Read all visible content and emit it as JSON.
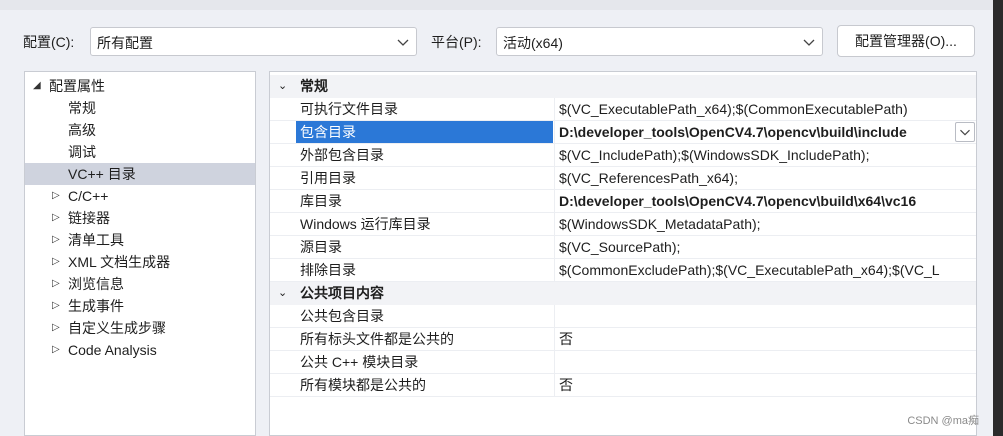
{
  "toolbar": {
    "config_label": "配置(C):",
    "config_value": "所有配置",
    "platform_label": "平台(P):",
    "platform_value": "活动(x64)",
    "manager_button": "配置管理器(O)..."
  },
  "tree": {
    "root": "配置属性",
    "items": [
      {
        "label": "常规",
        "expandable": false
      },
      {
        "label": "高级",
        "expandable": false
      },
      {
        "label": "调试",
        "expandable": false
      },
      {
        "label": "VC++ 目录",
        "expandable": false,
        "selected": true
      },
      {
        "label": "C/C++",
        "expandable": true
      },
      {
        "label": "链接器",
        "expandable": true
      },
      {
        "label": "清单工具",
        "expandable": true
      },
      {
        "label": "XML 文档生成器",
        "expandable": true
      },
      {
        "label": "浏览信息",
        "expandable": true
      },
      {
        "label": "生成事件",
        "expandable": true
      },
      {
        "label": "自定义生成步骤",
        "expandable": true
      },
      {
        "label": "Code Analysis",
        "expandable": true
      }
    ]
  },
  "grid": {
    "sections": [
      {
        "title": "常规",
        "rows": [
          {
            "key": "可执行文件目录",
            "value": "$(VC_ExecutablePath_x64);$(CommonExecutablePath)",
            "bold": false
          },
          {
            "key": "包含目录",
            "value": "D:\\developer_tools\\OpenCV4.7\\opencv\\build\\include",
            "bold": true,
            "selected": true
          },
          {
            "key": "外部包含目录",
            "value": "$(VC_IncludePath);$(WindowsSDK_IncludePath);",
            "bold": false
          },
          {
            "key": "引用目录",
            "value": "$(VC_ReferencesPath_x64);",
            "bold": false
          },
          {
            "key": "库目录",
            "value": "D:\\developer_tools\\OpenCV4.7\\opencv\\build\\x64\\vc16",
            "bold": true
          },
          {
            "key": "Windows 运行库目录",
            "value": "$(WindowsSDK_MetadataPath);",
            "bold": false
          },
          {
            "key": "源目录",
            "value": "$(VC_SourcePath);",
            "bold": false
          },
          {
            "key": "排除目录",
            "value": "$(CommonExcludePath);$(VC_ExecutablePath_x64);$(VC_L",
            "bold": false
          }
        ]
      },
      {
        "title": "公共项目内容",
        "rows": [
          {
            "key": "公共包含目录",
            "value": "",
            "bold": false
          },
          {
            "key": "所有标头文件都是公共的",
            "value": "否",
            "bold": false
          },
          {
            "key": "公共 C++ 模块目录",
            "value": "",
            "bold": false
          },
          {
            "key": "所有模块都是公共的",
            "value": "否",
            "bold": false
          }
        ]
      }
    ]
  },
  "watermark": "CSDN @ma痴",
  "colors": {
    "dialog_bg": "#eef0f5",
    "selection_blue": "#2b78d7",
    "tree_selected": "#cfd3de"
  }
}
